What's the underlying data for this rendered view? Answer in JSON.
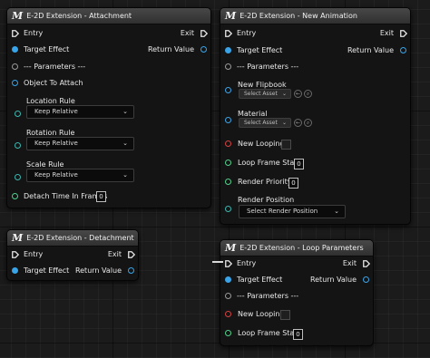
{
  "nodes": {
    "attachment": {
      "title": "E-2D Extension - Attachment",
      "entry": "Entry",
      "exit": "Exit",
      "target_effect": "Target Effect",
      "return_value": "Return Value",
      "parameters": "--- Parameters ---",
      "object_to_attach": "Object To Attach",
      "location_rule": {
        "label": "Location Rule",
        "value": "Keep Relative"
      },
      "rotation_rule": {
        "label": "Rotation Rule",
        "value": "Keep Relative"
      },
      "scale_rule": {
        "label": "Scale Rule",
        "value": "Keep Relative"
      },
      "detach_time": {
        "label": "Detach Time In Frames",
        "value": "0"
      }
    },
    "detachment": {
      "title": "E-2D Extension - Detachment",
      "entry": "Entry",
      "exit": "Exit",
      "target_effect": "Target Effect",
      "return_value": "Return Value"
    },
    "new_animation": {
      "title": "E-2D Extension - New Animation",
      "entry": "Entry",
      "exit": "Exit",
      "target_effect": "Target Effect",
      "return_value": "Return Value",
      "parameters": "--- Parameters ---",
      "new_flipbook": {
        "label": "New Flipbook",
        "asset": "Select Asset"
      },
      "material": {
        "label": "Material",
        "asset": "Select Asset"
      },
      "new_looping": "New Looping",
      "loop_frame_start": {
        "label": "Loop Frame Start",
        "value": "0"
      },
      "render_priority": {
        "label": "Render Priority",
        "value": "0"
      },
      "render_position": {
        "label": "Render Position",
        "value": "Select Render Position"
      }
    },
    "loop_parameters": {
      "title": "E-2D Extension - Loop Parameters",
      "entry": "Entry",
      "exit": "Exit",
      "target_effect": "Target Effect",
      "return_value": "Return Value",
      "parameters": "--- Parameters ---",
      "new_looping": "New Looping",
      "loop_frame_start": {
        "label": "Loop Frame Start",
        "value": "0"
      }
    }
  },
  "icons": {
    "node_icon": "M",
    "dropdown_chevron": "⌄",
    "asset_chevron": "⌄",
    "use_selected": "←",
    "browse": "⌕"
  },
  "colors": {
    "object_pin": "#3aa4e8",
    "bool_pin": "#d64040",
    "int_pin": "#4fd18b",
    "byte_pin": "#3ab7b0",
    "exec_pin": "#e6e6e6"
  }
}
